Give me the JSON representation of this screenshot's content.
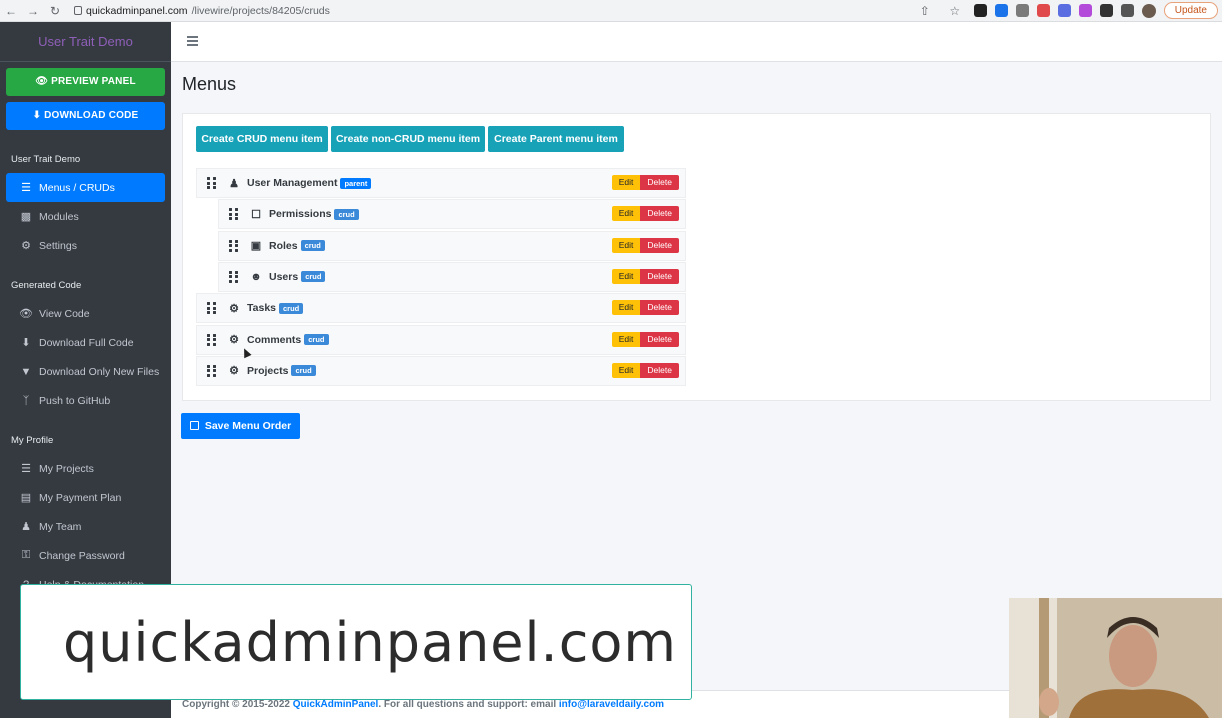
{
  "browser": {
    "url_host": "quickadminpanel.com",
    "url_path": "/livewire/projects/84205/cruds",
    "update_label": "Update"
  },
  "sidebar": {
    "brand": "User Trait Demo",
    "preview_label": "PREVIEW PANEL",
    "download_label": "DOWNLOAD CODE",
    "sections": [
      {
        "title": "User Trait Demo",
        "items": [
          {
            "label": "Menus / CRUDs",
            "icon": "list-icon",
            "active": true
          },
          {
            "label": "Modules",
            "icon": "cubes-icon"
          },
          {
            "label": "Settings",
            "icon": "wrench-icon"
          }
        ]
      },
      {
        "title": "Generated Code",
        "items": [
          {
            "label": "View Code",
            "icon": "eye-icon"
          },
          {
            "label": "Download Full Code",
            "icon": "download-icon"
          },
          {
            "label": "Download Only New Files",
            "icon": "download-circle-icon"
          },
          {
            "label": "Push to GitHub",
            "icon": "branch-icon"
          }
        ]
      },
      {
        "title": "My Profile",
        "items": [
          {
            "label": "My Projects",
            "icon": "list-icon"
          },
          {
            "label": "My Payment Plan",
            "icon": "credit-card-icon"
          },
          {
            "label": "My Team",
            "icon": "users-icon"
          },
          {
            "label": "Change Password",
            "icon": "key-icon"
          },
          {
            "label": "Help & Documentation",
            "icon": "question-icon"
          }
        ]
      }
    ]
  },
  "main": {
    "title": "Menus",
    "buttons": {
      "create_crud": "Create CRUD menu item",
      "create_non_crud": "Create non-CRUD menu item",
      "create_parent": "Create Parent menu item"
    },
    "rows": [
      {
        "name": "User Management",
        "badge": "parent",
        "icon": "users-icon",
        "child": false
      },
      {
        "name": "Permissions",
        "badge": "crud",
        "icon": "unlock-icon",
        "child": true
      },
      {
        "name": "Roles",
        "badge": "crud",
        "icon": "briefcase-icon",
        "child": true
      },
      {
        "name": "Users",
        "badge": "crud",
        "icon": "user-icon",
        "child": true
      },
      {
        "name": "Tasks",
        "badge": "crud",
        "icon": "cogs-icon",
        "child": false
      },
      {
        "name": "Comments",
        "badge": "crud",
        "icon": "cogs-icon",
        "child": false
      },
      {
        "name": "Projects",
        "badge": "crud",
        "icon": "cogs-icon",
        "child": false
      }
    ],
    "edit_label": "Edit",
    "delete_label": "Delete",
    "save_label": "Save Menu Order"
  },
  "footer": {
    "prefix": "Copyright © 2015-2022 ",
    "brand_link": "QuickAdminPanel",
    "middle": ". For all questions and support: email ",
    "email": "info@laraveldaily.com"
  },
  "overlay": {
    "text": "quickadminpanel.com"
  },
  "colors": {
    "sidebar_bg": "#343a40",
    "primary": "#007bff",
    "success": "#28a745",
    "info": "#17a2b8",
    "warning": "#ffc107",
    "danger": "#dc3545",
    "brand": "#8f5fb8"
  }
}
